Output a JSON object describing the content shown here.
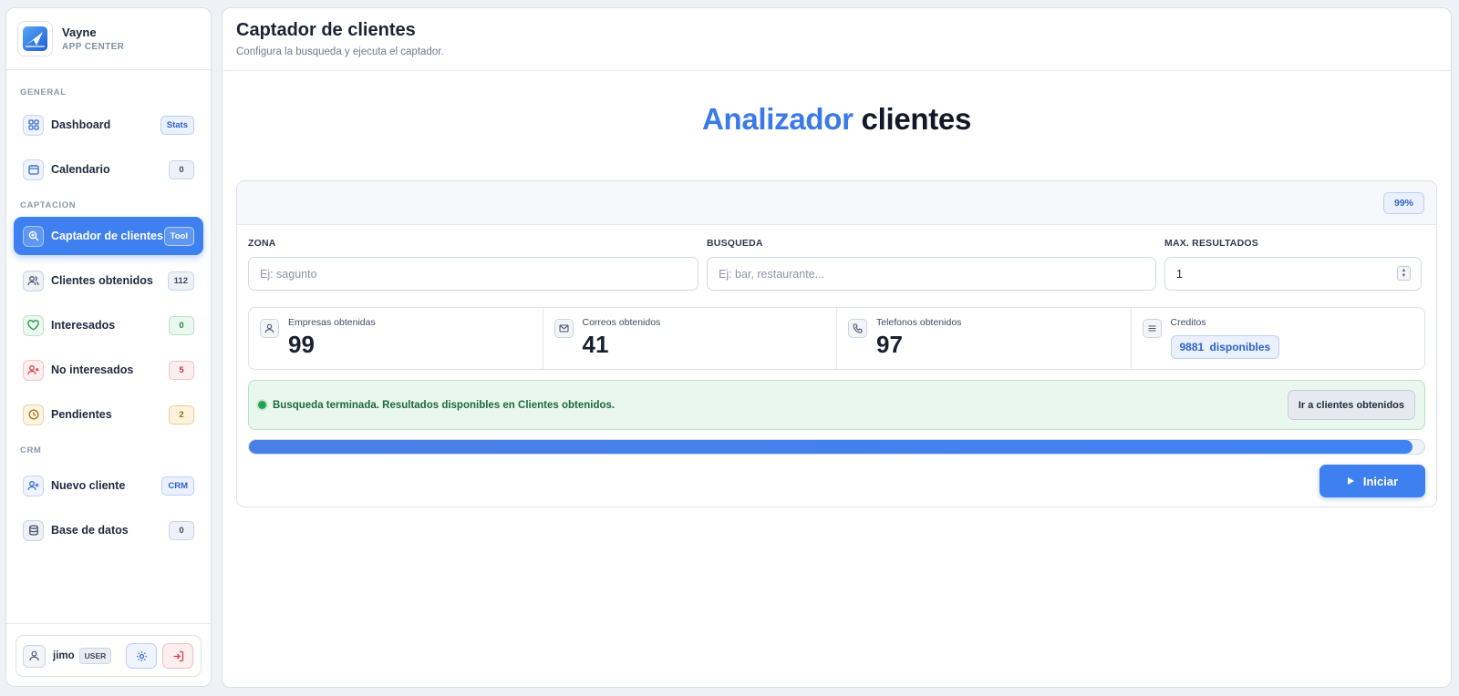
{
  "brand": {
    "name": "Vayne",
    "subtitle": "APP CENTER",
    "logo_icon": "logo-icon"
  },
  "sidebar": {
    "sections": [
      {
        "label": "GENERAL"
      },
      {
        "label": "CAPTACION"
      },
      {
        "label": "CRM"
      }
    ],
    "items": [
      {
        "label": "Dashboard",
        "badge": "Stats",
        "icon": "grid-icon"
      },
      {
        "label": "Calendario",
        "badge": "0",
        "icon": "calendar-icon"
      },
      {
        "label": "Captador de clientes",
        "badge": "Tool",
        "icon": "search-icon",
        "active": true
      },
      {
        "label": "Clientes obtenidos",
        "badge": "112",
        "icon": "users-icon"
      },
      {
        "label": "Interesados",
        "badge": "0",
        "icon": "heart-icon"
      },
      {
        "label": "No interesados",
        "badge": "5",
        "icon": "user-minus-icon"
      },
      {
        "label": "Pendientes",
        "badge": "2",
        "icon": "clock-icon"
      },
      {
        "label": "Nuevo cliente",
        "badge": "CRM",
        "icon": "user-plus-icon"
      },
      {
        "label": "Base de datos",
        "badge": "0",
        "icon": "database-icon"
      }
    ],
    "user": {
      "name": "jimo",
      "role": "USER"
    }
  },
  "header": {
    "title": "Captador de clientes",
    "subtitle": "Configura la busqueda y ejecuta el captador."
  },
  "hero": {
    "accent": "Analizador",
    "rest": "clientes"
  },
  "panel": {
    "percent_badge": "99%",
    "fields": {
      "zona": {
        "label": "ZONA",
        "placeholder": "Ej: sagunto",
        "value": ""
      },
      "busqueda": {
        "label": "BUSQUEDA",
        "placeholder": "Ej: bar, restaurante...",
        "value": ""
      },
      "max": {
        "label": "MAX. RESULTADOS",
        "value": "1"
      }
    },
    "stats": {
      "empresas": {
        "label": "Empresas obtenidas",
        "value": "99"
      },
      "correos": {
        "label": "Correos obtenidos",
        "value": "41"
      },
      "telefonos": {
        "label": "Telefonos obtenidos",
        "value": "97"
      },
      "creditos": {
        "label": "Creditos",
        "value": "9881 disponibles"
      }
    },
    "alert": {
      "text": "Busqueda terminada. Resultados disponibles en Clientes obtenidos.",
      "button": "Ir a clientes obtenidos"
    },
    "progress": 0.99,
    "start_button": "Iniciar"
  },
  "colors": {
    "accent": "#3e80ef",
    "success": "#27a150",
    "danger": "#c8383f",
    "warning": "#a36a07"
  }
}
